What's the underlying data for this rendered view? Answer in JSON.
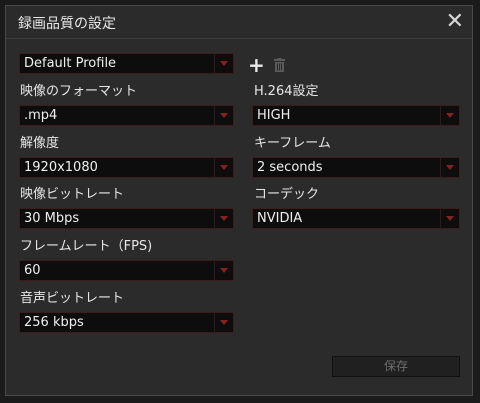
{
  "dialog": {
    "title": "録画品質の設定",
    "close_label": "✕"
  },
  "profile": {
    "value": "Default Profile",
    "add_label": "+"
  },
  "left": {
    "format_label": "映像のフォーマット",
    "format_value": ".mp4",
    "resolution_label": "解像度",
    "resolution_value": "1920x1080",
    "video_bitrate_label": "映像ビットレート",
    "video_bitrate_value": "30 Mbps",
    "framerate_label": "フレームレート（FPS)",
    "framerate_value": "60",
    "audio_bitrate_label": "音声ビットレート",
    "audio_bitrate_value": "256 kbps"
  },
  "right": {
    "h264_label": "H.264設定",
    "h264_value": "HIGH",
    "keyframe_label": "キーフレーム",
    "keyframe_value": "2 seconds",
    "codec_label": "コーデック",
    "codec_value": "NVIDIA"
  },
  "footer": {
    "save_label": "保存"
  },
  "colors": {
    "dialog_bg": "#2b2b2b",
    "field_bg": "#0d0d0d",
    "arrow_accent": "#8a1f1f",
    "text": "#e6e6e6"
  }
}
